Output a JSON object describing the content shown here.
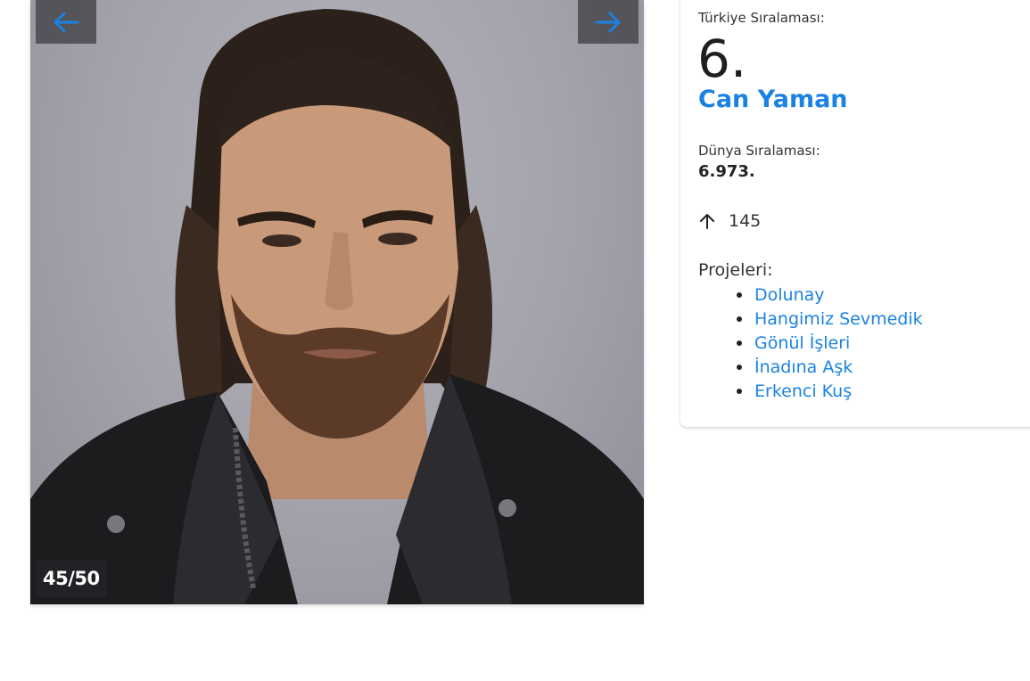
{
  "gallery": {
    "prev_icon": "arrow-left-icon",
    "next_icon": "arrow-right-icon",
    "counter": "45/50",
    "accent_color": "#1a82e2"
  },
  "profile": {
    "turkey_rank_label": "Türkiye Sıralaması:",
    "turkey_rank": "6.",
    "name": "Can Yaman",
    "world_rank_label": "Dünya Sıralaması:",
    "world_rank": "6.973.",
    "change_icon": "arrow-up-icon",
    "change_value": "145",
    "projects_label": "Projeleri:",
    "projects": [
      "Dolunay",
      "Hangimiz Sevmedik",
      "Gönül İşleri",
      "İnadına Aşk",
      "Erkenci Kuş"
    ]
  }
}
